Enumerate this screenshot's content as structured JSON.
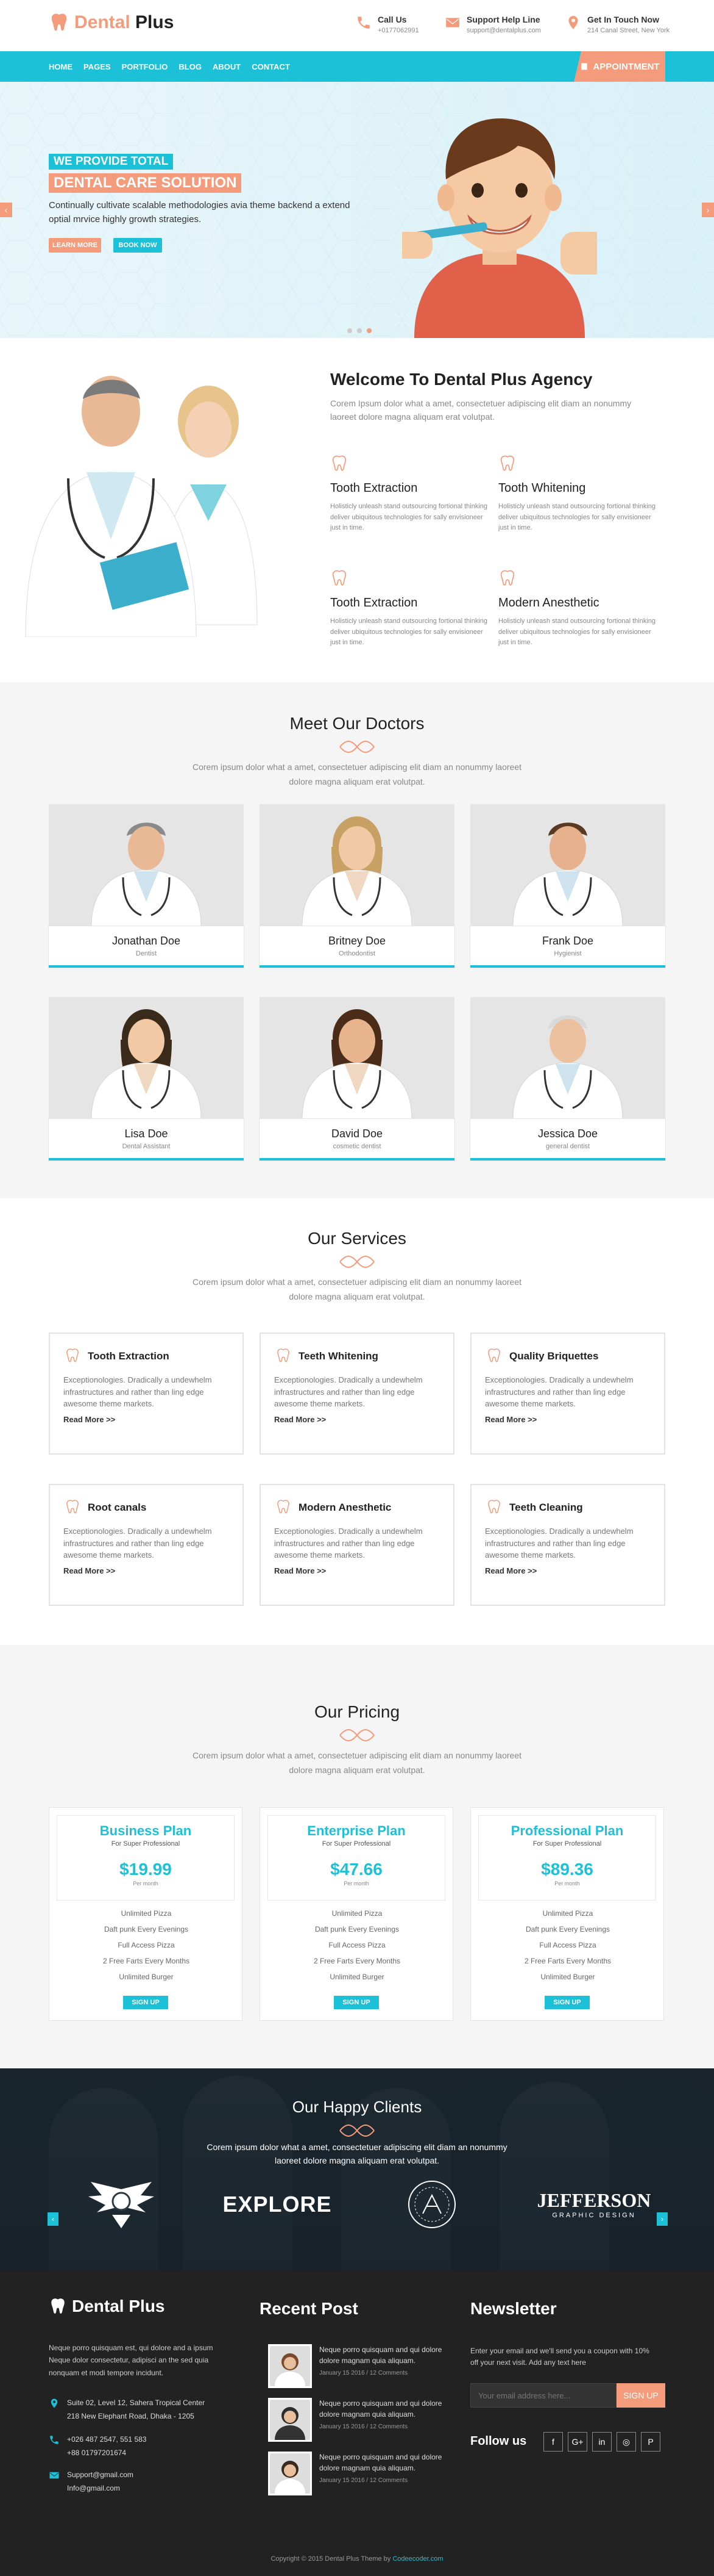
{
  "brand": {
    "name_a": "Dental",
    "name_b": "Plus"
  },
  "header": {
    "contacts": [
      {
        "icon": "phone-icon",
        "title": "Call Us",
        "detail": "+0177062991"
      },
      {
        "icon": "mail-icon",
        "title": "Support Help Line",
        "detail": "support@dentalplus.com"
      },
      {
        "icon": "location-icon",
        "title": "Get In Touch Now",
        "detail": "214 Canal Street, New York"
      }
    ]
  },
  "nav": {
    "items": [
      "HOME",
      "PAGES",
      "PORTFOLIO",
      "BLOG",
      "ABOUT",
      "CONTACT"
    ],
    "appointment": "APPOINTMENT"
  },
  "hero": {
    "tag1": "WE PROVIDE TOTAL",
    "tag2": "DENTAL CARE SOLUTION",
    "desc": "Continually cultivate scalable methodologies avia theme backend a extend optial mrvice highly growth strategies.",
    "btn_learn": "LEARN MORE",
    "btn_book": "BOOK NOW",
    "prev": "‹",
    "next": "›"
  },
  "welcome": {
    "title": "Welcome To Dental Plus Agency",
    "desc": "Corem Ipsum dolor what a amet, consectetuer adipiscing elit diam an nonummy laoreet dolore magna aliquam erat volutpat.",
    "features": [
      {
        "title": "Tooth Extraction",
        "desc": "Holisticly unleash stand outsourcing fortional thinking deliver ubiquitous technologies for sally envisioneer just in time."
      },
      {
        "title": "Tooth Whitening",
        "desc": "Holisticly unleash stand outsourcing fortional thinking deliver ubiquitous technologies for sally envisioneer just in time."
      },
      {
        "title": "Tooth Extraction",
        "desc": "Holisticly unleash stand outsourcing fortional thinking deliver ubiquitous technologies for sally envisioneer just in time."
      },
      {
        "title": "Modern Anesthetic",
        "desc": "Holisticly unleash stand outsourcing fortional thinking deliver ubiquitous technologies for sally envisioneer just in time."
      }
    ]
  },
  "doctors": {
    "title": "Meet Our Doctors",
    "desc": "Corem ipsum dolor what a amet, consectetuer adipiscing elit diam an nonummy laoreet dolore magna aliquam erat volutpat.",
    "items": [
      {
        "name": "Jonathan Doe",
        "role": "Dentist"
      },
      {
        "name": "Britney Doe",
        "role": "Orthodontist"
      },
      {
        "name": "Frank Doe",
        "role": "Hygienist"
      },
      {
        "name": "Lisa Doe",
        "role": "Dental Assistant"
      },
      {
        "name": "David Doe",
        "role": "cosmetic dentist"
      },
      {
        "name": "Jessica Doe",
        "role": "general dentist"
      }
    ]
  },
  "services": {
    "title": "Our Services",
    "desc": "Corem ipsum dolor what a amet, consectetuer adipiscing elit diam an nonummy laoreet dolore magna aliquam erat volutpat.",
    "read_more": "Read More >>",
    "items": [
      {
        "title": "Tooth Extraction",
        "desc": "Exceptionologies. Dradically a undewhelm infrastructures and rather than ling edge awesome theme markets."
      },
      {
        "title": "Teeth Whitening",
        "desc": "Exceptionologies. Dradically a undewhelm infrastructures and rather than ling edge awesome theme markets."
      },
      {
        "title": "Quality Briquettes",
        "desc": "Exceptionologies. Dradically a undewhelm infrastructures and rather than ling edge awesome theme markets."
      },
      {
        "title": "Root canals",
        "desc": "Exceptionologies. Dradically a undewhelm infrastructures and rather than ling edge awesome theme markets."
      },
      {
        "title": "Modern Anesthetic",
        "desc": "Exceptionologies. Dradically a undewhelm infrastructures and rather than ling edge awesome theme markets."
      },
      {
        "title": "Teeth Cleaning",
        "desc": "Exceptionologies. Dradically a undewhelm infrastructures and rather than ling edge awesome theme markets."
      }
    ]
  },
  "pricing": {
    "title": "Our Pricing",
    "desc": "Corem ipsum dolor what a amet, consectetuer adipiscing elit diam an nonummy laoreet dolore magna aliquam erat volutpat.",
    "signup": "SIGN UP",
    "per": "Per month",
    "features": [
      "Unlimited Pizza",
      "Daft punk Every Evenings",
      "Full Access Pizza",
      "2 Free Farts Every Months",
      "Unlimited Burger"
    ],
    "plans": [
      {
        "name": "Business Plan",
        "sub": "For Super Professional",
        "price": "$19.99"
      },
      {
        "name": "Enterprise Plan",
        "sub": "For Super Professional",
        "price": "$47.66"
      },
      {
        "name": "Professional Plan",
        "sub": "For Super Professional",
        "price": "$89.36"
      }
    ]
  },
  "clients": {
    "title": "Our Happy Clients",
    "desc": "Corem ipsum dolor what a amet, consectetuer adipiscing elit diam an nonummy laoreet dolore magna aliquam erat volutpat.",
    "logos": [
      "EXPLORE",
      "JEFFERSON"
    ],
    "logo_sub": "GRAPHIC DESIGN"
  },
  "footer": {
    "about": "Neque porro quisquam est, qui dolore and a ipsum Neque dolor consectetur, adipisci an the sed quia nonquam et modi tempore incidunt.",
    "address": [
      "Suite 02, Level 12, Sahera Tropical Center",
      "218 New Elephant Road, Dhaka - 1205"
    ],
    "phones": [
      "+026 487 2547, 551 583",
      "+88 01797201674"
    ],
    "emails": [
      "Support@gmail.com",
      "Info@gmail.com"
    ],
    "recent_title": "Recent Post",
    "posts": [
      {
        "text": "Neque porro quisquam and qui dolore dolore magnam quia aliquam.",
        "meta": "January 15 2016 / 12 Comments"
      },
      {
        "text": "Neque porro quisquam and qui dolore dolore magnam quia aliquam.",
        "meta": "January 15 2016 / 12 Comments"
      },
      {
        "text": "Neque porro quisquam and qui dolore dolore magnam quia aliquam.",
        "meta": "January 15 2016 / 12 Comments"
      }
    ],
    "newsletter_title": "Newsletter",
    "newsletter_desc": "Enter your email and we'll send you a coupon with 10% off your next visit. Add any text here",
    "email_placeholder": "Your email address here...",
    "signup_btn": "SIGN UP",
    "follow": "Follow us",
    "social": [
      "f",
      "G+",
      "in",
      "◎",
      "P"
    ],
    "copyright": "Copyright © 2015 Dental Plus Theme by",
    "copyright_link": "Codeecoder.com"
  },
  "colors": {
    "accent": "#1dc1d7",
    "brand": "#f39b7a",
    "dark": "#222222"
  }
}
